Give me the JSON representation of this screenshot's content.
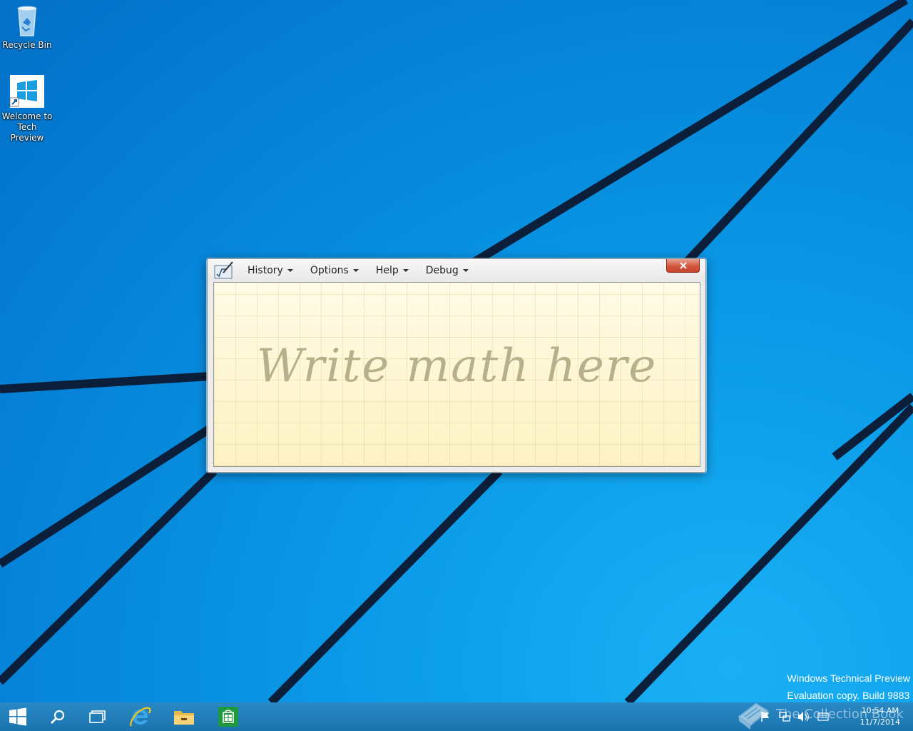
{
  "desktop": {
    "icons": [
      {
        "label": "Recycle Bin",
        "icon": "recycle-bin-icon"
      },
      {
        "label": "Welcome to Tech Preview",
        "label_line1": "Welcome to",
        "label_line2": "Tech Preview",
        "icon": "windows-logo-icon"
      }
    ],
    "watermark": {
      "line1": "Windows Technical Preview",
      "line2": "Evaluation copy. Build 9883"
    },
    "overlay_logo_text": "The Collection Book"
  },
  "math_window": {
    "menu": [
      {
        "label": "History"
      },
      {
        "label": "Options"
      },
      {
        "label": "Help"
      },
      {
        "label": "Debug"
      }
    ],
    "close_glyph": "✕",
    "pad_prompt": "Write math here"
  },
  "taskbar": {
    "buttons": [
      "start-button",
      "search-button",
      "task-view-button",
      "internet-explorer-button",
      "file-explorer-button",
      "store-button"
    ],
    "clock": {
      "time": "10:54 AM",
      "date": "11/7/2014"
    }
  },
  "colors": {
    "desktop_blue": "#0a8ee0",
    "taskbar": "#1a73ae",
    "close_red": "#c7442b",
    "pad_yellow": "#fdf2c4"
  }
}
